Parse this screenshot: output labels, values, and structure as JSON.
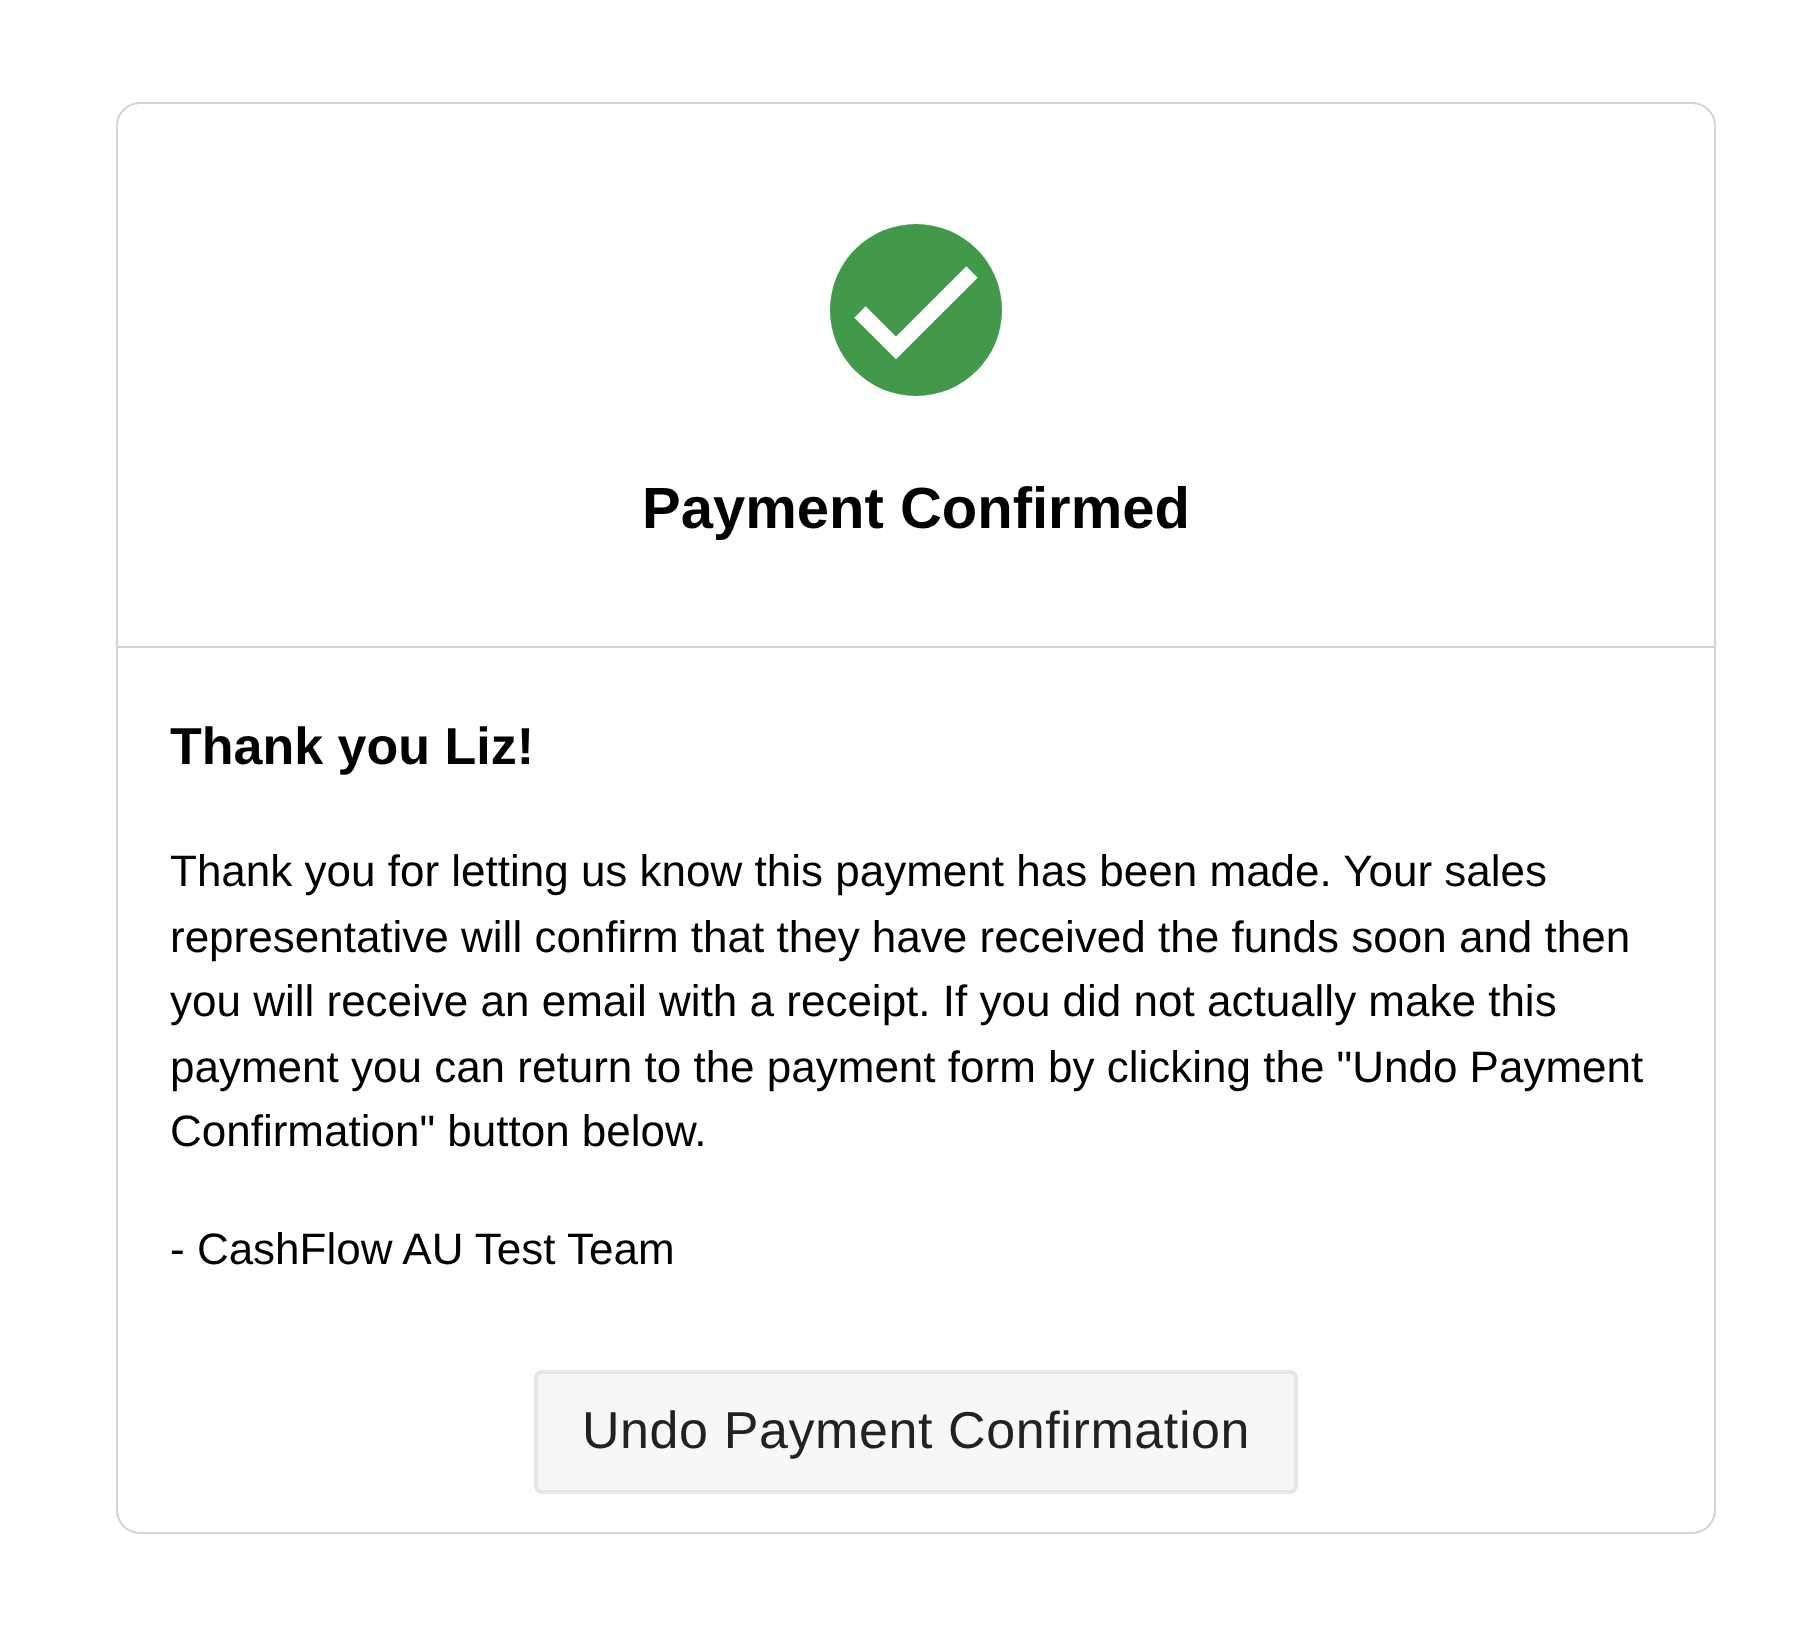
{
  "header": {
    "title": "Payment Confirmed"
  },
  "body": {
    "heading": "Thank you Liz!",
    "message": "Thank you for letting us know this payment has been made. Your sales representative will confirm that they have received the funds soon and then you will receive an email with a receipt. If you did not actually make this payment you can return to the payment form by clicking the \"Undo Payment Confirmation\" button below.",
    "signature": "- CashFlow AU Test Team"
  },
  "buttons": [
    {
      "label": "Undo Payment Confirmation"
    }
  ]
}
